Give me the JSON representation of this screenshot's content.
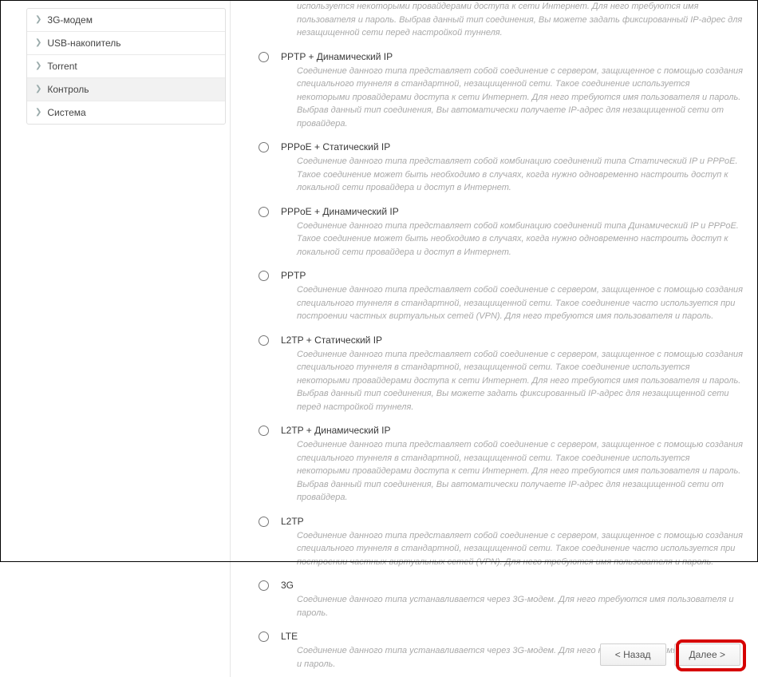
{
  "sidebar": {
    "items": [
      {
        "label": "3G-модем"
      },
      {
        "label": "USB-накопитель"
      },
      {
        "label": "Torrent"
      },
      {
        "label": "Контроль"
      },
      {
        "label": "Система"
      }
    ]
  },
  "top_cut": {
    "desc": "используется некоторыми провайдерами доступа к сети Интернет. Для него требуются имя пользователя и пароль. Выбрав данный тип соединения, Вы можете задать фиксированный IP-адрес для незащищенной сети перед настройкой туннеля."
  },
  "options": [
    {
      "label": "PPTP + Динамический IP",
      "desc": "Соединение данного типа представляет собой соединение с сервером, защищенное с помощью создания специального туннеля в стандартной, незащищенной сети. Такое соединение используется некоторыми провайдерами доступа к сети Интернет. Для него требуются имя пользователя и пароль. Выбрав данный тип соединения, Вы автоматически получаете IP-адрес для незащищенной сети от провайдера."
    },
    {
      "label": "PPPoE + Статический IP",
      "desc": "Соединение данного типа представляет собой комбинацию соединений типа Статический IP и PPPoE. Такое соединение может быть необходимо в случаях, когда нужно одновременно настроить доступ к локальной сети провайдера и доступ в Интернет."
    },
    {
      "label": "PPPoE + Динамический IP",
      "desc": "Соединение данного типа представляет собой комбинацию соединений типа Динамический IP и PPPoE. Такое соединение может быть необходимо в случаях, когда нужно одновременно настроить доступ к локальной сети провайдера и доступ в Интернет."
    },
    {
      "label": "PPTP",
      "desc": "Соединение данного типа представляет собой соединение с сервером, защищенное с помощью создания специального туннеля в стандартной, незащищенной сети. Такое соединение часто используется при построении частных виртуальных сетей (VPN). Для него требуются имя пользователя и пароль."
    },
    {
      "label": "L2TP + Статический IP",
      "desc": "Соединение данного типа представляет собой соединение с сервером, защищенное с помощью создания специального туннеля в стандартной, незащищенной сети. Такое соединение используется некоторыми провайдерами доступа к сети Интернет. Для него требуются имя пользователя и пароль. Выбрав данный тип соединения, Вы можете задать фиксированный IP-адрес для незащищенной сети перед настройкой туннеля."
    },
    {
      "label": "L2TP + Динамический IP",
      "desc": "Соединение данного типа представляет собой соединение с сервером, защищенное с помощью создания специального туннеля в стандартной, незащищенной сети. Такое соединение используется некоторыми провайдерами доступа к сети Интернет. Для него требуются имя пользователя и пароль. Выбрав данный тип соединения, Вы автоматически получаете IP-адрес для незащищенной сети от провайдера."
    },
    {
      "label": "L2TP",
      "desc": "Соединение данного типа представляет собой соединение с сервером, защищенное с помощью создания специального туннеля в стандартной, незащищенной сети. Такое соединение часто используется при построении частных виртуальных сетей (VPN). Для него требуются имя пользователя и пароль."
    },
    {
      "label": "3G",
      "desc": "Соединение данного типа устанавливается через 3G-модем. Для него требуются имя пользователя и пароль."
    },
    {
      "label": "LTE",
      "desc": "Соединение данного типа устанавливается через 3G-модем. Для него не требуются имя пользователя и пароль."
    }
  ],
  "buttons": {
    "back": "< Назад",
    "next": "Далее >"
  }
}
